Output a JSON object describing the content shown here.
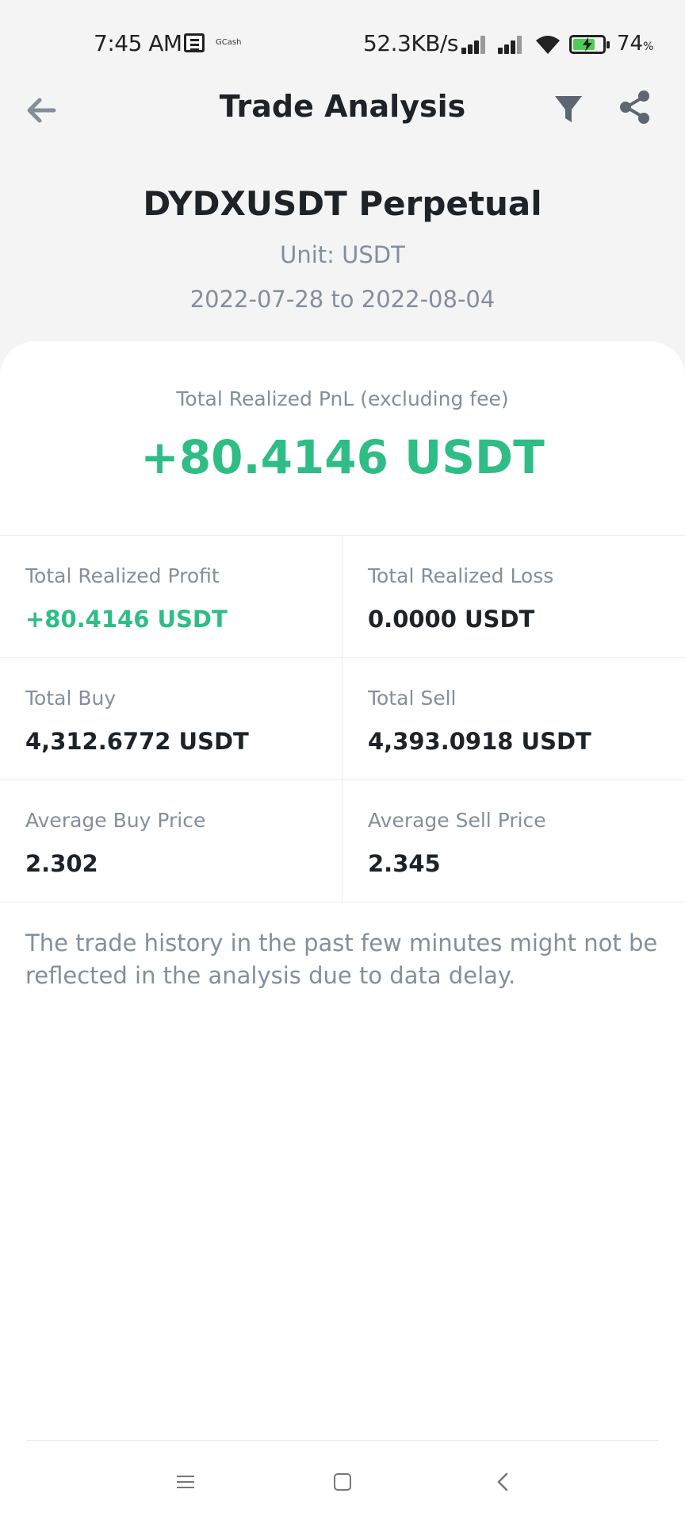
{
  "status_bar": {
    "time": "7:45 AM",
    "gcash_label": "GCash",
    "net_speed": "52.3KB/s",
    "battery_percent": "74",
    "battery_unit": "%",
    "battery_level": 0.74,
    "icons": [
      "news-icon",
      "signal-icon",
      "signal-icon",
      "wifi-icon",
      "battery-charging-icon"
    ]
  },
  "app_bar": {
    "title": "Trade Analysis",
    "back_icon": "arrow-left-icon",
    "filter_icon": "filter-icon",
    "share_icon": "share-icon"
  },
  "header": {
    "contract": "DYDXUSDT Perpetual",
    "unit": "Unit: USDT",
    "date_range": "2022-07-28 to 2022-08-04"
  },
  "summary": {
    "pnl_label": "Total Realized PnL (excluding fee)",
    "pnl_value": "+80.4146 USDT"
  },
  "stats": [
    {
      "left": {
        "label": "Total Realized Profit",
        "value": "+80.4146 USDT"
      },
      "right": {
        "label": "Total Realized Loss",
        "value": "0.0000 USDT"
      }
    },
    {
      "left": {
        "label": "Total Buy",
        "value": "4,312.6772 USDT"
      },
      "right": {
        "label": "Total Sell",
        "value": "4,393.0918 USDT"
      }
    },
    {
      "left": {
        "label": "Average Buy Price",
        "value": "2.302"
      },
      "right": {
        "label": "Average Sell Price",
        "value": "2.345"
      }
    }
  ],
  "note": "The trade history in the past few minutes might not be reflected in the analysis due to data delay.",
  "colors": {
    "profit_green": "#2ebd85",
    "text_primary": "#1e2329",
    "text_secondary": "#848e9c",
    "page_background": "#f4f4f5",
    "card_background": "#ffffff"
  },
  "nav_bar": {
    "icons": [
      "menu-icon",
      "home-square-icon",
      "back-chevron-icon"
    ]
  }
}
